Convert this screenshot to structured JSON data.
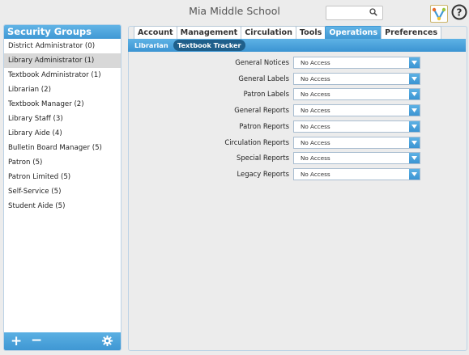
{
  "header": {
    "school_name": "Mia Middle School",
    "search_value": ""
  },
  "sidebar": {
    "title": "Security Groups",
    "items": [
      {
        "label": "District Administrator (0)"
      },
      {
        "label": "Library Administrator (1)"
      },
      {
        "label": "Textbook Administrator (1)"
      },
      {
        "label": "Librarian (2)"
      },
      {
        "label": "Textbook Manager (2)"
      },
      {
        "label": "Library Staff (3)"
      },
      {
        "label": "Library Aide (4)"
      },
      {
        "label": "Bulletin Board Manager (5)"
      },
      {
        "label": "Patron (5)"
      },
      {
        "label": "Patron Limited (5)"
      },
      {
        "label": "Self-Service (5)"
      },
      {
        "label": "Student Aide (5)"
      }
    ],
    "selected_index": 1
  },
  "tabs": [
    "Account",
    "Management",
    "Circulation",
    "Tools",
    "Operations",
    "Preferences"
  ],
  "active_tab": "Operations",
  "subtabs": [
    "Librarian",
    "Textbook Tracker"
  ],
  "active_subtab": "Textbook Tracker",
  "permissions": [
    {
      "label": "General Notices",
      "value": "No Access"
    },
    {
      "label": "General Labels",
      "value": "No Access"
    },
    {
      "label": "Patron Labels",
      "value": "No Access"
    },
    {
      "label": "General Reports",
      "value": "No Access"
    },
    {
      "label": "Patron Reports",
      "value": "No Access"
    },
    {
      "label": "Circulation Reports",
      "value": "No Access"
    },
    {
      "label": "Special Reports",
      "value": "No Access"
    },
    {
      "label": "Legacy Reports",
      "value": "No Access"
    }
  ],
  "colors": {
    "accent": "#3f98d4",
    "accent_dark": "#1f5f8b"
  },
  "icons": {
    "search": "magnifier-icon",
    "app": "app-logo-icon",
    "help": "help-icon",
    "add": "plus-icon",
    "remove": "minus-icon",
    "settings": "gear-icon",
    "dropdown": "chevron-down-icon"
  }
}
